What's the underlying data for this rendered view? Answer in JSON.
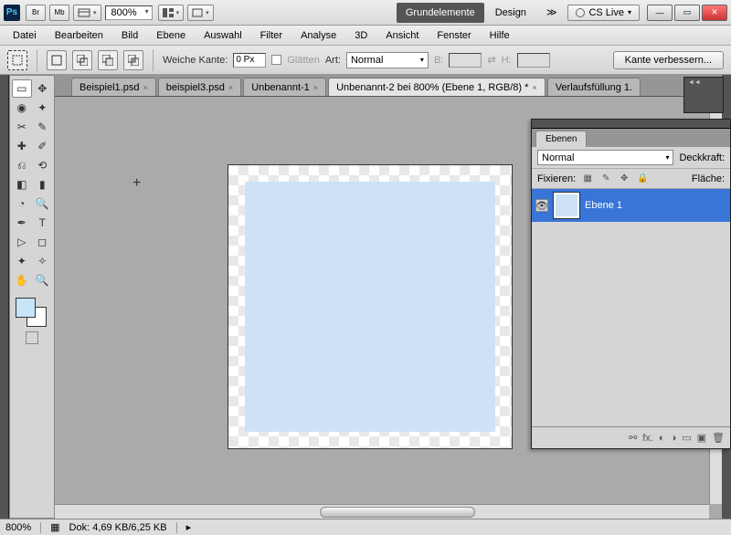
{
  "titlebar": {
    "br": "Br",
    "mb": "Mb",
    "zoom": "800%",
    "ws1": "Grundelemente",
    "ws2": "Design",
    "cslive": "CS Live"
  },
  "menus": [
    "Datei",
    "Bearbeiten",
    "Bild",
    "Ebene",
    "Auswahl",
    "Filter",
    "Analyse",
    "3D",
    "Ansicht",
    "Fenster",
    "Hilfe"
  ],
  "options": {
    "feather_label": "Weiche Kante:",
    "feather_value": "0 Px",
    "antialias": "Glätten",
    "style_label": "Art:",
    "style_value": "Normal",
    "width_label": "B:",
    "height_label": "H:",
    "refine": "Kante verbessern..."
  },
  "tabs": [
    {
      "label": "Beispiel1.psd",
      "active": false
    },
    {
      "label": "beispiel3.psd",
      "active": false
    },
    {
      "label": "Unbenannt-1",
      "active": false
    },
    {
      "label": "Unbenannt-2 bei 800% (Ebene 1, RGB/8) *",
      "active": true
    },
    {
      "label": "Verlaufsfüllung 1.",
      "active": false
    }
  ],
  "status": {
    "zoom": "800%",
    "doc": "Dok: 4,69 KB/6,25 KB"
  },
  "panel": {
    "tab": "Ebenen",
    "blend": "Normal",
    "opacity_label": "Deckkraft:",
    "lock_label": "Fixieren:",
    "fill_label": "Fläche:",
    "layer1": "Ebene 1",
    "fx": "fx."
  }
}
